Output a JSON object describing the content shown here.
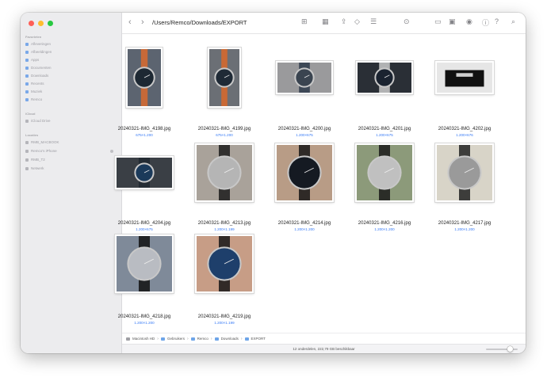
{
  "window": {
    "path_title": "/Users/Remco/Downloads/EXPORT"
  },
  "sidebar": {
    "sections": [
      {
        "label": "Favorieten",
        "items": [
          {
            "label": "Afleveringen",
            "icon": "airdrop-icon"
          },
          {
            "label": "Afbeeldingen",
            "icon": "image-icon"
          },
          {
            "label": "Apps",
            "icon": "apps-icon"
          },
          {
            "label": "Documenten",
            "icon": "document-icon"
          },
          {
            "label": "Downloads",
            "icon": "download-icon"
          },
          {
            "label": "Recents",
            "icon": "clock-icon"
          },
          {
            "label": "Muziek",
            "icon": "music-icon"
          },
          {
            "label": "Remco",
            "icon": "home-icon"
          }
        ]
      },
      {
        "label": "iCloud",
        "items": [
          {
            "label": "iCloud Drive",
            "icon": "cloud-icon"
          }
        ]
      },
      {
        "label": "Locaties",
        "items": [
          {
            "label": "RMB_MACBOOK",
            "icon": "laptop-icon"
          },
          {
            "label": "Remco's iPhone",
            "icon": "phone-icon"
          },
          {
            "label": "RMB_T2",
            "icon": "drive-icon"
          },
          {
            "label": "Netwerk",
            "icon": "network-icon"
          }
        ]
      }
    ]
  },
  "toolbar": {
    "back_icon": "chevron-left-icon",
    "forward_icon": "chevron-right-icon",
    "icons": [
      "grid-view-icon",
      "group-icon",
      "share-icon",
      "tag-icon",
      "list-options-icon",
      "more-icon",
      "new-folder-icon",
      "preview-icon",
      "eye-icon",
      "info-icon",
      "help-icon",
      "search-icon"
    ]
  },
  "files": [
    {
      "name": "20240321-IMG_4198.jpg",
      "dims": "675×1.200"
    },
    {
      "name": "20240321-IMG_4199.jpg",
      "dims": "675×1.200"
    },
    {
      "name": "20240321-IMG_4200.jpg",
      "dims": "1.200×675"
    },
    {
      "name": "20240321-IMG_4201.jpg",
      "dims": "1.200×675"
    },
    {
      "name": "20240321-IMG_4202.jpg",
      "dims": "1.200×676"
    },
    {
      "name": "20240321-IMG_4204.jpg",
      "dims": "1.200×675"
    },
    {
      "name": "20240321-IMG_4213.jpg",
      "dims": "1.200×1.199"
    },
    {
      "name": "20240321-IMG_4214.jpg",
      "dims": "1.200×1.200"
    },
    {
      "name": "20240321-IMG_4216.jpg",
      "dims": "1.200×1.200"
    },
    {
      "name": "20240321-IMG_4217.jpg",
      "dims": "1.200×1.200"
    },
    {
      "name": "20240321-IMG_4218.jpg",
      "dims": "1.200×1.200"
    },
    {
      "name": "20240321-IMG_4219.jpg",
      "dims": "1.200×1.199"
    }
  ],
  "pathbar": {
    "segments": [
      "Macintosh HD",
      "Gebruikers",
      "Remco",
      "Downloads",
      "EXPORT"
    ]
  },
  "status": {
    "text": "12 onderdelen, 222,79 GB beschikbaar"
  }
}
